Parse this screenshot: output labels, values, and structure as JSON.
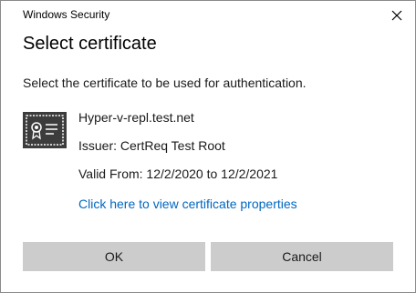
{
  "window": {
    "title": "Windows Security",
    "close_icon": "close-icon"
  },
  "dialog": {
    "heading": "Select certificate",
    "instructions": "Select the certificate to be used for authentication."
  },
  "certificate": {
    "icon": "certificate-icon",
    "name": "Hyper-v-repl.test.net",
    "issuer": "Issuer: CertReq Test Root",
    "valid": "Valid From: 12/2/2020 to 12/2/2021",
    "properties_link": "Click here to view certificate properties"
  },
  "buttons": {
    "ok": "OK",
    "cancel": "Cancel"
  },
  "colors": {
    "link": "#0067c0",
    "button_bg": "#cccccc",
    "icon_bg": "#3c3c3c"
  }
}
